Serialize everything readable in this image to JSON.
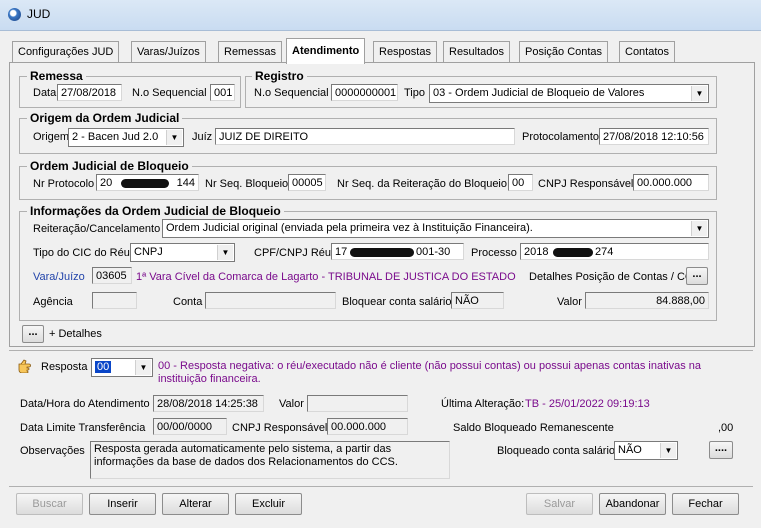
{
  "window": {
    "title": "JUD"
  },
  "tabs": [
    "Configurações JUD",
    "Varas/Juízos",
    "Remessas",
    "Atendimento",
    "Respostas",
    "Resultados",
    "Posição Contas",
    "Contatos"
  ],
  "remessa": {
    "title": "Remessa",
    "data_label": "Data",
    "data_value": "27/08/2018",
    "seq_label": "N.o Sequencial",
    "seq_value": "001"
  },
  "registro": {
    "title": "Registro",
    "seq_label": "N.o Sequencial",
    "seq_value": "0000000001",
    "tipo_label": "Tipo",
    "tipo_value": "03 - Ordem Judicial de Bloqueio de Valores"
  },
  "origem": {
    "title": "Origem da Ordem Judicial",
    "origem_label": "Origem",
    "origem_value": "2 - Bacen Jud 2.0",
    "juiz_label": "Juíz",
    "juiz_value": "JUIZ DE DIREITO",
    "protocolamento_label": "Protocolamento",
    "protocolamento_value": "27/08/2018 12:10:56"
  },
  "ordem": {
    "title": "Ordem Judicial de Bloqueio",
    "nr_protocolo_label": "Nr Protocolo",
    "nr_protocolo_value": "20",
    "nr_protocolo_suffix": "144",
    "nr_seq_bloqueio_label": "Nr Seq. Bloqueio",
    "nr_seq_bloqueio_value": "00005",
    "nr_seq_reiteracao_label": "Nr Seq. da Reiteração do Bloqueio",
    "nr_seq_reiteracao_value": "00",
    "cnpj_resp_label": "CNPJ Responsável",
    "cnpj_resp_value": "00.000.000"
  },
  "info": {
    "title": "Informações da Ordem Judicial de Bloqueio",
    "reiteracao_label": "Reiteração/Cancelamento",
    "reiteracao_value": "Ordem Judicial original (enviada pela primeira vez à Instituição Financeira).",
    "tipo_cic_label": "Tipo do CIC do Réu",
    "tipo_cic_value": "CNPJ",
    "cpf_label": "CPF/CNPJ Réu",
    "cpf_prefix": "17",
    "cpf_suffix": "001-30",
    "processo_label": "Processo",
    "processo_prefix": "2018",
    "processo_suffix": "274",
    "vara_label": "Vara/Juízo",
    "vara_code": "03605",
    "vara_desc": "1ª Vara Cível da Comarca de Lagarto - TRIBUNAL DE JUSTICA DO ESTADO",
    "detalhes_pos_label": "Detalhes Posição de Contas / CCS",
    "detalhes_pos_button": "...",
    "agencia_label": "Agência",
    "agencia_value": "",
    "conta_label": "Conta",
    "conta_value": "",
    "bloquear_label": "Bloquear conta salário",
    "bloquear_value": "NÃO",
    "valor_label": "Valor",
    "valor_value": "84.888,00"
  },
  "detalhes": {
    "button": "...",
    "label": "+ Detalhes"
  },
  "resposta": {
    "label": "Resposta",
    "code": "00",
    "description": "00 - Resposta negativa: o réu/executado não é cliente (não possui contas) ou possui apenas contas inativas na instituição financeira.",
    "data_hora_label": "Data/Hora do Atendimento",
    "data_hora_value": "28/08/2018 14:25:38",
    "valor_label": "Valor",
    "valor_value": "",
    "ultima_label": "Última Alteração:",
    "ultima_value": "TB - 25/01/2022 09:19:13",
    "data_limite_label": "Data Limite Transferência",
    "data_limite_value": "00/00/0000",
    "cnpj_label": "CNPJ Responsável",
    "cnpj_value": "00.000.000",
    "saldo_label": "Saldo Bloqueado Remanescente",
    "saldo_value": ",00",
    "obs_label": "Observações",
    "obs_value": "Resposta gerada automaticamente pelo sistema, a partir das informações da base de dados dos Relacionamentos do CCS.",
    "bloqueado_label": "Bloqueado conta salário",
    "bloqueado_value": "NÃO",
    "bloqueado_button": "...."
  },
  "buttons": {
    "buscar": "Buscar",
    "inserir": "Inserir",
    "alterar": "Alterar",
    "excluir": "Excluir",
    "salvar": "Salvar",
    "abandonar": "Abandonar",
    "fechar": "Fechar"
  }
}
